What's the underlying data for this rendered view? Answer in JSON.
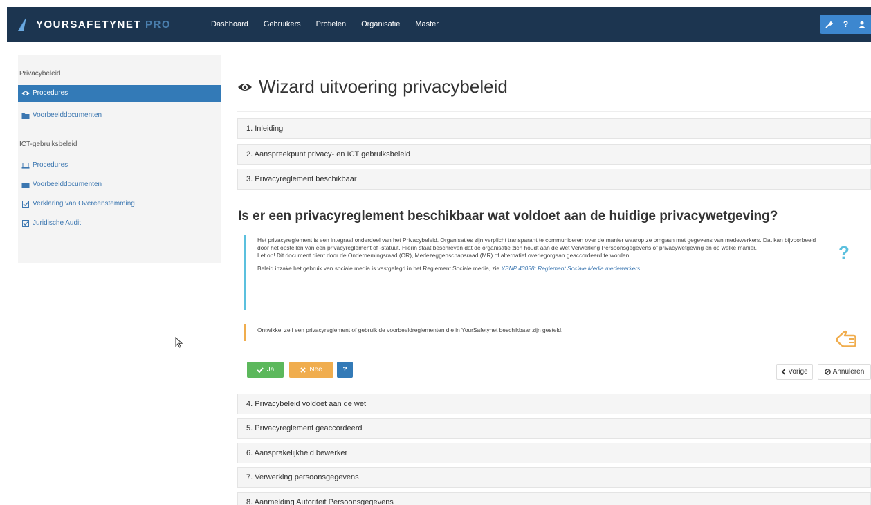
{
  "navbar": {
    "brand": "YOURSAFETYNET",
    "brand_suffix": "PRO",
    "links": [
      "Dashboard",
      "Gebruikers",
      "Profielen",
      "Organisatie",
      "Master"
    ],
    "right_icons": [
      "wrench-icon",
      "help-icon",
      "user-icon"
    ],
    "right_help_label": "?"
  },
  "sidebar": {
    "sections": [
      {
        "header": "Privacybeleid",
        "items": [
          {
            "label": "Procedures",
            "icon": "eye-icon",
            "active": true
          },
          {
            "label": "Voorbeelddocumenten",
            "icon": "folder-icon",
            "active": false
          }
        ]
      },
      {
        "header": "ICT-gebruiksbeleid",
        "items": [
          {
            "label": "Procedures",
            "icon": "laptop-icon",
            "active": false
          },
          {
            "label": "Voorbeelddocumenten",
            "icon": "folder-icon",
            "active": false
          },
          {
            "label": "Verklaring van Overeenstemming",
            "icon": "check-square-icon",
            "active": false
          },
          {
            "label": "Juridische Audit",
            "icon": "check-square-icon",
            "active": false
          }
        ]
      }
    ]
  },
  "main": {
    "title": "Wizard uitvoering privacybeleid",
    "steps_before": [
      "1. Inleiding",
      "2. Aanspreekpunt privacy- en ICT gebruiksbeleid",
      "3. Privacyreglement beschikbaar"
    ],
    "question": "Is er een privacyreglement beschikbaar wat voldoet aan de huidige privacywetgeving?",
    "info_paragraph_1": "Het privacyreglement is een integraal onderdeel van het Privacybeleid. Organisaties zijn verplicht transparant te communiceren over de manier waarop ze omgaan met gegevens van medewerkers. Dat kan bijvoorbeeld door het opstellen van een privacyreglement of -statuut. Hierin staat beschreven dat de organisatie zich houdt aan de Wet Verwerking Persoonsgegevens of privacywetgeving en op welke manier.",
    "info_paragraph_2": "Let op! Dit document dient door de Ondernemingsraad (OR), Medezeggenschapsraad (MR) of alternatief overlegorgaan geaccordeerd te worden.",
    "info_paragraph_3_prefix": "Beleid inzake het gebruik van sociale media is vastgelegd in het Reglement Sociale media, zie",
    "info_link": "YSNP 43058: Reglement Sociale Media medewerkers.",
    "warning_text": "Ontwikkel zelf een privacyreglement of gebruik de voorbeeldreglementen die in YourSafetynet beschikbaar zijn gesteld.",
    "help_glyph": "?",
    "buttons": {
      "yes": "Ja",
      "no": "Nee",
      "help": "?",
      "previous": "Vorige",
      "cancel": "Annuleren"
    },
    "steps_after": [
      "4. Privacybeleid voldoet aan de wet",
      "5. Privacyreglement geaccordeerd",
      "6. Aansprakelijkheid bewerker",
      "7. Verwerking persoonsgegevens",
      "8. Aanmelding Autoriteit Persoonsgegevens"
    ]
  },
  "colors": {
    "navbar_bg": "#1c3550",
    "accent": "#337ab7",
    "info": "#5bc0de",
    "warning": "#f0ad4e",
    "success": "#5cb85c"
  }
}
